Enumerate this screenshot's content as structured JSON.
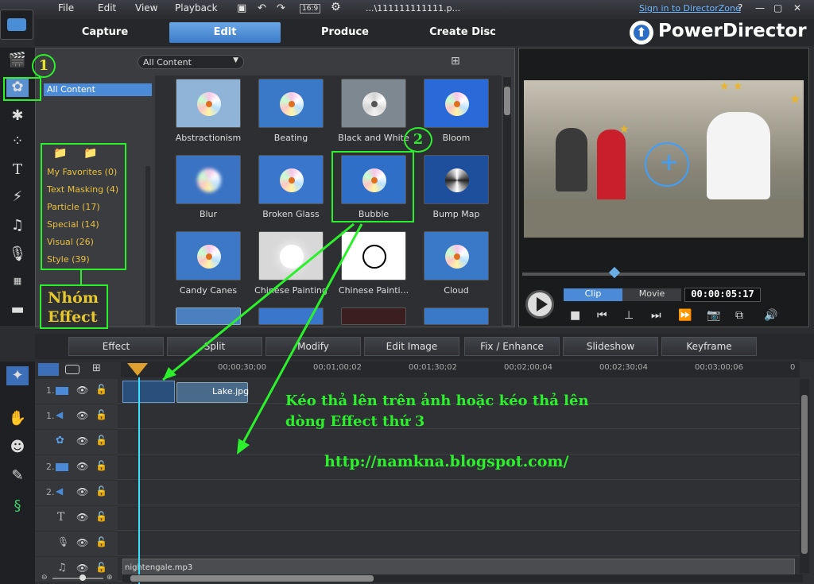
{
  "menubar": {
    "items": [
      "File",
      "Edit",
      "View",
      "Playback"
    ],
    "ratio": "16:9",
    "filename": "...\\111111111111.p...",
    "signin_link": "Sign in to DirectorZone",
    "help": "?",
    "window_controls": {
      "min": "—",
      "max": "▢",
      "close": "✕"
    }
  },
  "tabs": {
    "capture": "Capture",
    "edit": "Edit",
    "produce": "Produce",
    "create_disc": "Create Disc"
  },
  "brand": "PowerDirector",
  "library": {
    "filter": "All Content",
    "tree_selected": "All Content",
    "groups": [
      "My Favorites  (0)",
      "Text Masking  (4)",
      "Particle  (17)",
      "Special  (14)",
      "Visual  (26)",
      "Style  (39)"
    ],
    "effects": [
      {
        "label": "Abstractionism",
        "bg": "#8fb4d8"
      },
      {
        "label": "Beating",
        "bg": "#3a79c8"
      },
      {
        "label": "Black and White",
        "bg": "#7d8891"
      },
      {
        "label": "Bloom",
        "bg": "#2a6ad8"
      },
      {
        "label": "Blur",
        "bg": "#3b73c4"
      },
      {
        "label": "Broken Glass",
        "bg": "#3a77cc"
      },
      {
        "label": "Bubble",
        "bg": "#2f6fc8"
      },
      {
        "label": "Bump Map",
        "bg": "#1d4f9c"
      },
      {
        "label": "Candy Canes",
        "bg": "#3c78c6"
      },
      {
        "label": "Chinese Painting",
        "bg": "#d8d8d8"
      },
      {
        "label": "Chinese Painti...",
        "bg": "#ffffff"
      },
      {
        "label": "Cloud",
        "bg": "#3a78c8"
      }
    ]
  },
  "annotations": {
    "circle1": "1",
    "circle2": "2",
    "group_note_line1": "Nhóm",
    "group_note_line2": "Effect",
    "instruction_line1": "Kéo thả lên trên ảnh hoặc kéo thả lên",
    "instruction_line2": "dòng Effect thứ 3",
    "url": "http://namkna.blogspot.com/"
  },
  "preview": {
    "mode_clip": "Clip",
    "mode_movie": "Movie",
    "timecode": "00:00:05:17"
  },
  "toolbar": [
    "Effect",
    "Split",
    "Modify",
    "Edit Image",
    "Fix / Enhance",
    "Slideshow",
    "Keyframe"
  ],
  "timeline": {
    "ruler": [
      "00;00;30;00",
      "00;01;00;02",
      "00;01;30;02",
      "00;02;00;04",
      "00;02;30;04",
      "00;03;00;06",
      "0"
    ],
    "tracks": [
      {
        "label": "1.",
        "icon": "video-track-icon"
      },
      {
        "label": "1.",
        "icon": "audio-track-icon"
      },
      {
        "label": "",
        "icon": "effect-track-icon"
      },
      {
        "label": "2.",
        "icon": "video-track-icon"
      },
      {
        "label": "2.",
        "icon": "audio-track-icon"
      },
      {
        "label": "",
        "icon": "title-track-icon"
      },
      {
        "label": "",
        "icon": "voice-track-icon"
      },
      {
        "label": "",
        "icon": "music-track-icon"
      }
    ],
    "clip_label": "Lake.jpg",
    "audio_clip": "nightengale.mp3"
  },
  "colors": {
    "accent": "#3c7cc8",
    "annotation": "#2cf02c",
    "tab_active": "#5a96dc"
  }
}
